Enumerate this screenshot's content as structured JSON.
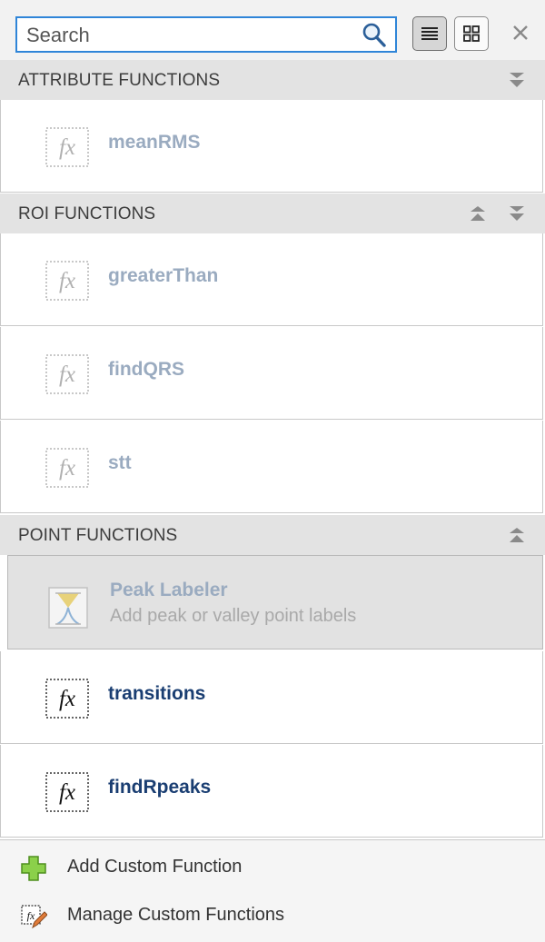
{
  "search": {
    "placeholder": "Search",
    "value": ""
  },
  "toolbar": {
    "list_view_icon": "list-icon",
    "grid_view_icon": "grid-icon",
    "close_icon": "close-icon"
  },
  "sections": {
    "attribute": {
      "title": "ATTRIBUTE FUNCTIONS",
      "items": [
        {
          "label": "meanRMS",
          "state": "disabled"
        }
      ]
    },
    "roi": {
      "title": "ROI FUNCTIONS",
      "items": [
        {
          "label": "greaterThan",
          "state": "disabled"
        },
        {
          "label": "findQRS",
          "state": "disabled"
        },
        {
          "label": "stt",
          "state": "disabled"
        }
      ]
    },
    "point": {
      "title": "POINT FUNCTIONS",
      "items": [
        {
          "label": "Peak Labeler",
          "description": "Add peak or valley point labels",
          "state": "selected-disabled"
        },
        {
          "label": "transitions",
          "state": "enabled"
        },
        {
          "label": "findRpeaks",
          "state": "enabled"
        }
      ]
    }
  },
  "actions": {
    "add": "Add Custom Function",
    "manage": "Manage Custom Functions"
  },
  "colors": {
    "accent": "#2f85d8",
    "header_bg": "#e3e3e3",
    "enabled_text": "#1a3e72",
    "disabled_text": "#9aabc0",
    "add_icon": "#7cc23c"
  }
}
